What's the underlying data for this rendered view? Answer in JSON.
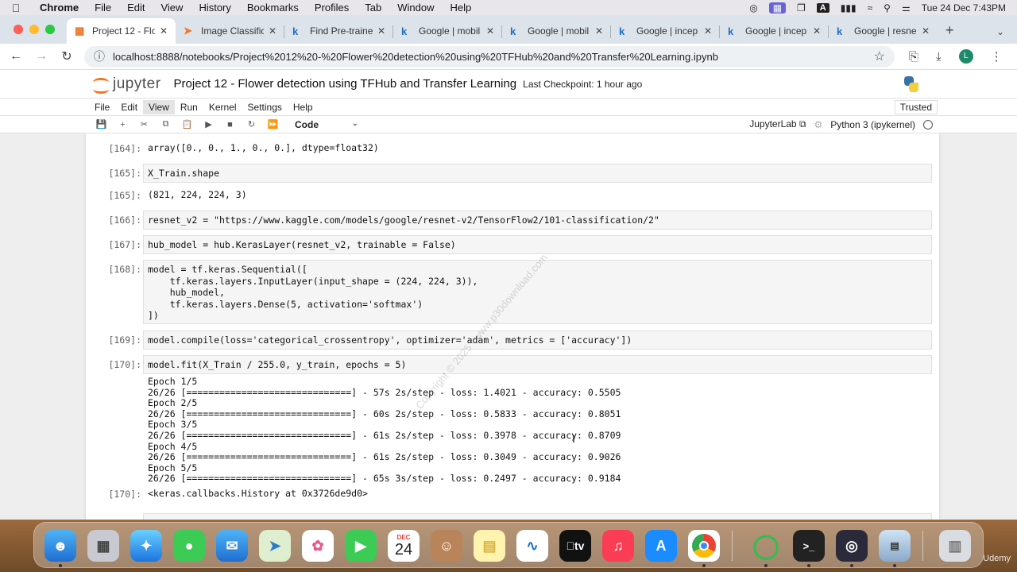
{
  "menubar": {
    "app": "Chrome",
    "items": [
      "File",
      "Edit",
      "View",
      "History",
      "Bookmarks",
      "Profiles",
      "Tab",
      "Window",
      "Help"
    ],
    "clock": "Tue 24 Dec  7:43PM"
  },
  "tabs": [
    {
      "label": "Project 12 - Flo",
      "icon": "jupyter-icon"
    },
    {
      "label": "Image Classific",
      "icon": "tensorflow-icon"
    },
    {
      "label": "Find Pre-traine",
      "icon": "kaggle-icon"
    },
    {
      "label": "Google | mobil",
      "icon": "kaggle-icon"
    },
    {
      "label": "Google | mobil",
      "icon": "kaggle-icon"
    },
    {
      "label": "Google | incep",
      "icon": "kaggle-icon"
    },
    {
      "label": "Google | incep",
      "icon": "kaggle-icon"
    },
    {
      "label": "Google | resne",
      "icon": "kaggle-icon"
    }
  ],
  "address": {
    "url": "localhost:8888/notebooks/Project%2012%20-%20Flower%20detection%20using%20TFHub%20and%20Transfer%20Learning.ipynb",
    "avatar_initial": "L"
  },
  "jupyter": {
    "logo": "jupyter",
    "title": "Project 12 - Flower detection using TFHub and Transfer Learning",
    "checkpoint": "Last Checkpoint: 1 hour ago",
    "menu": [
      "File",
      "Edit",
      "View",
      "Run",
      "Kernel",
      "Settings",
      "Help"
    ],
    "trusted": "Trusted",
    "cell_type": "Code",
    "jupyterlab_link": "JupyterLab",
    "kernel": "Python 3 (ipykernel)"
  },
  "cells": {
    "out164": {
      "prompt": "[164]:",
      "text": "array([0., 0., 1., 0., 0.], dtype=float32)"
    },
    "in165": {
      "prompt": "[165]:",
      "code": "X_Train.shape"
    },
    "out165": {
      "prompt": "[165]:",
      "text": "(821, 224, 224, 3)"
    },
    "in166": {
      "prompt": "[166]:",
      "code": "resnet_v2 = \"https://www.kaggle.com/models/google/resnet-v2/TensorFlow2/101-classification/2\""
    },
    "in167": {
      "prompt": "[167]:",
      "code": "hub_model = hub.KerasLayer(resnet_v2, trainable = False)"
    },
    "in168": {
      "prompt": "[168]:",
      "code": "model = tf.keras.Sequential([\n    tf.keras.layers.InputLayer(input_shape = (224, 224, 3)),\n    hub_model,\n    tf.keras.layers.Dense(5, activation='softmax')\n])"
    },
    "in169": {
      "prompt": "[169]:",
      "code": "model.compile(loss='categorical_crossentropy', optimizer='adam', metrics = ['accuracy'])"
    },
    "in170": {
      "prompt": "[170]:",
      "code": "model.fit(X_Train / 255.0, y_train, epochs = 5)"
    },
    "stream170": {
      "text": "Epoch 1/5\n26/26 [==============================] - 57s 2s/step - loss: 1.4021 - accuracy: 0.5505\nEpoch 2/5\n26/26 [==============================] - 60s 2s/step - loss: 0.5833 - accuracy: 0.8051\nEpoch 3/5\n26/26 [==============================] - 61s 2s/step - loss: 0.3978 - accuracy: 0.8709\nEpoch 4/5\n26/26 [==============================] - 61s 2s/step - loss: 0.3049 - accuracy: 0.9026\nEpoch 5/5\n26/26 [==============================] - 65s 3s/step - loss: 0.2497 - accuracy: 0.9184"
    },
    "out170": {
      "prompt": "[170]:",
      "text": "<keras.callbacks.History at 0x3726de9d0>"
    }
  },
  "watermark": "Copyright © 2025 - www.p30download.com",
  "dock": {
    "calendar_month": "DEC",
    "calendar_day": "24",
    "tv_label": "tv",
    "udemy": "Udemy"
  }
}
